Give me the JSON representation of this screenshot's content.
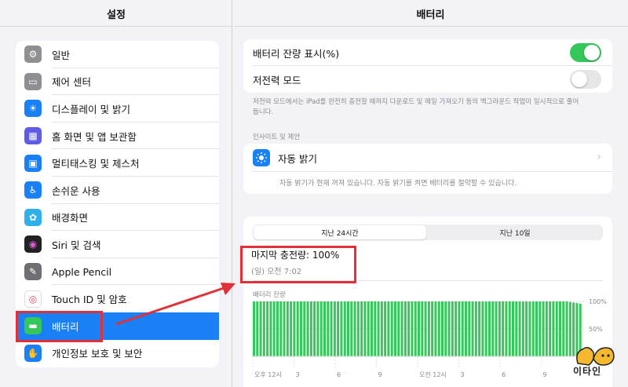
{
  "left": {
    "title": "설정",
    "items": [
      {
        "label": "일반",
        "icon": "gear-icon",
        "color": "#8e8e93"
      },
      {
        "label": "제어 센터",
        "icon": "toggles-icon",
        "color": "#8e8e93"
      },
      {
        "label": "디스플레이 및 밝기",
        "icon": "sun-icon",
        "color": "#1a80f5"
      },
      {
        "label": "홈 화면 및 앱 보관함",
        "icon": "grid-icon",
        "color": "#5e5ce6"
      },
      {
        "label": "멀티태스킹 및 제스처",
        "icon": "multitask-icon",
        "color": "#1a80f5"
      },
      {
        "label": "손쉬운 사용",
        "icon": "accessibility-icon",
        "color": "#1a80f5"
      },
      {
        "label": "배경화면",
        "icon": "flower-icon",
        "color": "#2fb0e8"
      },
      {
        "label": "Siri 및 검색",
        "icon": "siri-icon",
        "color": "#222222"
      },
      {
        "label": "Apple Pencil",
        "icon": "pencil-icon",
        "color": "#6e6e73"
      },
      {
        "label": "Touch ID 및 암호",
        "icon": "fingerprint-icon",
        "color": "#ffffff"
      },
      {
        "label": "배터리",
        "icon": "battery-icon",
        "color": "#34c759"
      },
      {
        "label": "개인정보 보호 및 보안",
        "icon": "hand-icon",
        "color": "#1a80f5"
      }
    ],
    "selected_index": 10
  },
  "right": {
    "title": "배터리",
    "battery_percentage": {
      "label": "배터리 잔량 표시(%)",
      "on": true
    },
    "low_power": {
      "label": "저전력 모드",
      "on": false
    },
    "low_power_footer": "저전력 모드에서는 iPad를 완전히 충전할 때까지 다운로드 및 메일 가져오기 등의 백그라운드 작업이 일시적으로 줄어듭니다.",
    "insights_header": "인사이트 및 제안",
    "auto_brightness": {
      "label": "자동 밝기",
      "desc": "자동 밝기가 현재 꺼져 있습니다. 자동 밝기를 켜면 배터리를 절약할 수 있습니다."
    },
    "segments": [
      "지난 24시간",
      "지난 10일"
    ],
    "last_charge": {
      "title": "마지막 충전량: 100%",
      "time": "(일) 오전 7:02"
    },
    "chart_title": "배터리 잔량"
  },
  "chart_data": {
    "type": "bar",
    "title": "배터리 잔량",
    "ylabel": "",
    "y_ticks": [
      "100%",
      "50%"
    ],
    "x_tick_labels": [
      "오후 12시",
      "3",
      "6",
      "9",
      "오전 12시",
      "3",
      "6",
      "9"
    ],
    "ylim": [
      0,
      100
    ],
    "values": [
      100,
      100,
      100,
      100,
      100,
      100,
      100,
      100,
      100,
      100,
      100,
      100,
      100,
      100,
      100,
      100,
      100,
      100,
      100,
      100,
      100,
      100,
      100,
      100,
      100,
      100,
      100,
      100,
      100,
      100,
      100,
      100,
      100,
      100,
      100,
      100,
      100,
      100,
      100,
      100,
      100,
      100,
      100,
      100,
      100,
      100,
      100,
      100,
      100,
      100,
      100,
      100,
      100,
      100,
      100,
      100,
      100,
      100,
      100,
      100,
      100,
      100,
      100,
      100,
      100,
      100,
      100,
      100,
      100,
      100,
      100,
      100,
      100,
      100,
      100,
      100,
      100,
      100,
      100,
      100,
      100,
      100,
      100,
      100,
      100,
      100,
      100,
      100,
      100,
      100,
      100,
      100,
      100,
      100,
      99,
      98,
      97,
      96
    ],
    "bar_color": "#34c759"
  },
  "watermark": "이타인",
  "annotation_color": "#e03138"
}
